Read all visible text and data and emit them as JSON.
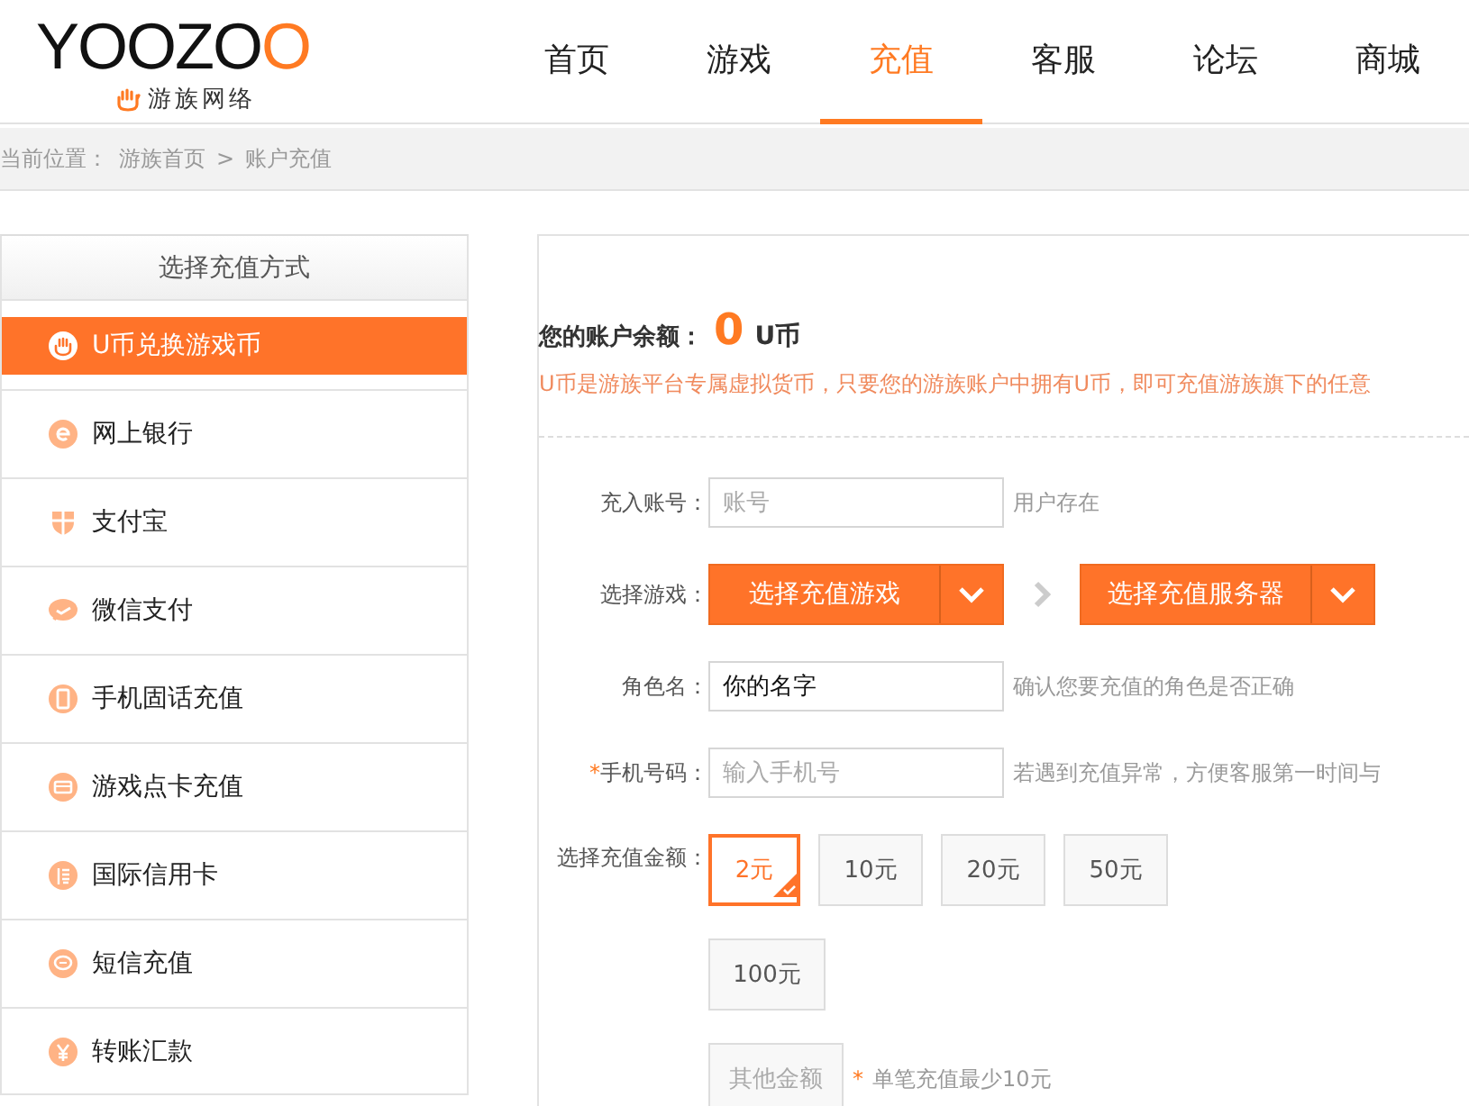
{
  "logo": {
    "wordmark": "YOOZOO",
    "tagline": "游族网络"
  },
  "nav": [
    {
      "label": "首页",
      "selected": false
    },
    {
      "label": "游戏",
      "selected": false
    },
    {
      "label": "充值",
      "selected": true
    },
    {
      "label": "客服",
      "selected": false
    },
    {
      "label": "论坛",
      "selected": false
    },
    {
      "label": "商城",
      "selected": false
    }
  ],
  "breadcrumb": {
    "label": "当前位置：",
    "separator": ">",
    "items": [
      "游族首页",
      "账户充值"
    ]
  },
  "sidebar": {
    "title": "选择充值方式",
    "items": [
      {
        "label": "U币兑换游戏币",
        "selected": true
      },
      {
        "label": "网上银行",
        "selected": false
      },
      {
        "label": "支付宝",
        "selected": false
      },
      {
        "label": "微信支付",
        "selected": false
      },
      {
        "label": "手机固话充值",
        "selected": false
      },
      {
        "label": "游戏点卡充值",
        "selected": false
      },
      {
        "label": "国际信用卡",
        "selected": false
      },
      {
        "label": "短信充值",
        "selected": false
      },
      {
        "label": "转账汇款",
        "selected": false
      }
    ]
  },
  "balance": {
    "label": "您的账户余额：",
    "amount": "0",
    "unit": "U币"
  },
  "notice": "U币是游族平台专属虚拟货币，只要您的游族账户中拥有U币，即可充值游族旗下的任意",
  "form": {
    "account": {
      "label": "充入账号：",
      "placeholder": "账号",
      "hint": "用户存在"
    },
    "game": {
      "label": "选择游戏：",
      "game_select": "选择充值游戏",
      "server_select": "选择充值服务器"
    },
    "role": {
      "label": "角色名：",
      "value": "你的名字",
      "hint": "确认您要充值的角色是否正确"
    },
    "phone": {
      "required_mark": "*",
      "label": "手机号码：",
      "placeholder": "输入手机号",
      "hint": "若遇到充值异常，方便客服第一时间与"
    },
    "amount": {
      "label": "选择充值金额：",
      "options": [
        {
          "label": "2元",
          "selected": true
        },
        {
          "label": "10元",
          "selected": false
        },
        {
          "label": "20元",
          "selected": false
        },
        {
          "label": "50元",
          "selected": false
        },
        {
          "label": "100元",
          "selected": false
        }
      ],
      "other_placeholder": "其他金额",
      "note_mark": "*",
      "note": "单笔充值最少10元"
    }
  }
}
